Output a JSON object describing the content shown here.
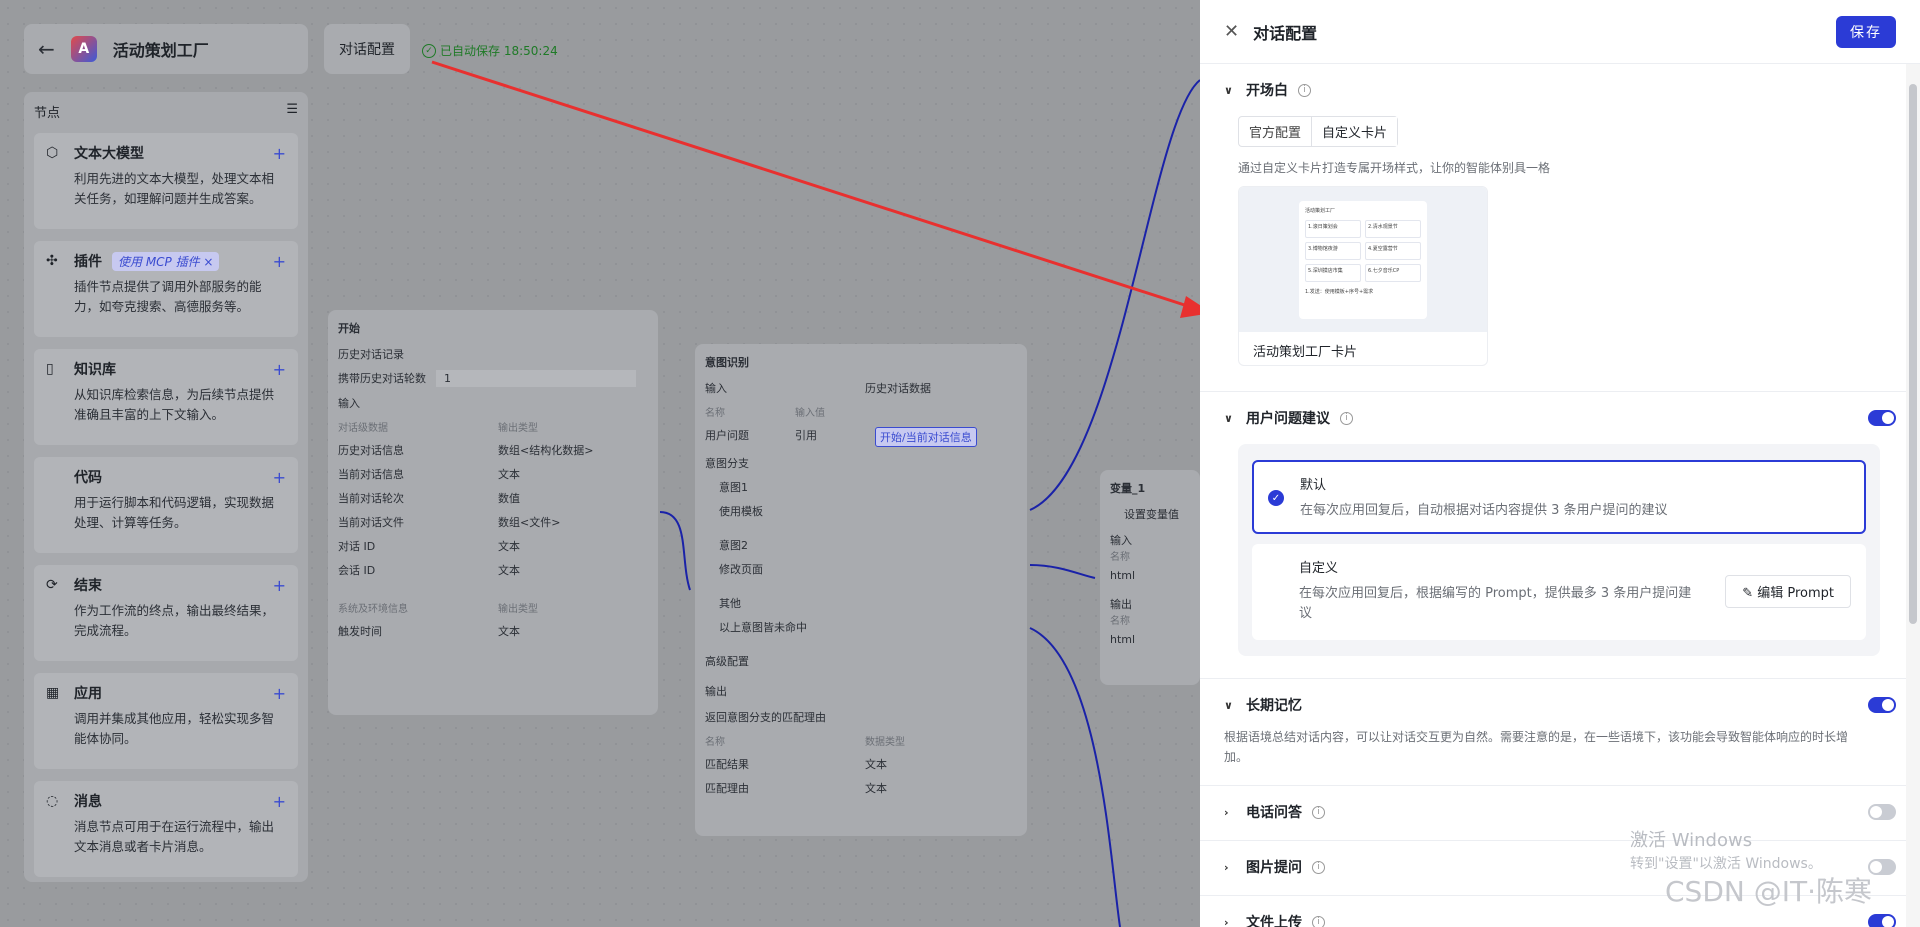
{
  "app": {
    "title": "活动策划工厂",
    "logo_letter": "A",
    "conv_tab": "对话配置",
    "autosave": "已自动保存 18:50:24"
  },
  "nodes": {
    "header": "节点",
    "items": [
      {
        "name": "文本大模型",
        "icon": "cube-icon",
        "desc": "利用先进的文本大模型，处理文本相关任务，如理解问题并生成答案。"
      },
      {
        "name": "插件",
        "icon": "puzzle-icon",
        "badge": "使用 MCP 插件 ×",
        "desc": "插件节点提供了调用外部服务的能力，如夸克搜索、高德服务等。"
      },
      {
        "name": "知识库",
        "icon": "book-icon",
        "desc": "从知识库检索信息，为后续节点提供准确且丰富的上下文输入。"
      },
      {
        "name": "代码",
        "icon": "code-icon",
        "desc": "用于运行脚本和代码逻辑，实现数据处理、计算等任务。"
      },
      {
        "name": "结束",
        "icon": "end-icon",
        "desc": "作为工作流的终点，输出最终结果，完成流程。"
      },
      {
        "name": "应用",
        "icon": "grid-icon",
        "desc": "调用并集成其他应用，轻松实现多智能体协同。"
      },
      {
        "name": "消息",
        "icon": "message-icon",
        "desc": "消息节点可用于在运行流程中，输出文本消息或者卡片消息。"
      }
    ]
  },
  "start_node": {
    "title": "开始",
    "history": "历史对话记录",
    "carry_label": "携带历史对话轮数",
    "carry_value": "1",
    "input": "输入",
    "col1": "对话级数据",
    "col2": "输出类型",
    "rows": [
      [
        "历史对话信息",
        "数组<结构化数据>"
      ],
      [
        "当前对话信息",
        "文本"
      ],
      [
        "当前对话轮次",
        "数值"
      ],
      [
        "当前对话文件",
        "数组<文件>"
      ],
      [
        "对话 ID",
        "文本"
      ],
      [
        "会话 ID",
        "文本"
      ]
    ],
    "col3": "系统及环境信息",
    "col4": "输出类型",
    "trigger": [
      "触发时间",
      "文本"
    ]
  },
  "intent_node": {
    "title": "意图识别",
    "input": "输入",
    "history_chk": "历史对话数据",
    "name_lbl": "名称",
    "val_lbl": "输入值",
    "user_q": "用户问题",
    "ref": "引用",
    "pill": "开始/当前对话信息",
    "branch": "意图分支",
    "i1": "意图1",
    "i1v": "使用模板",
    "i2": "意图2",
    "i2v": "修改页面",
    "other": "其他",
    "other_v": "以上意图皆未命中",
    "adv": "高级配置",
    "output": "输出",
    "ret": "返回意图分支的匹配理由",
    "oc1": "名称",
    "oc2": "数据类型",
    "out_rows": [
      [
        "匹配结果",
        "文本"
      ],
      [
        "匹配理由",
        "文本"
      ]
    ]
  },
  "var_node": {
    "title": "变量_1",
    "btn": "设置变量值",
    "input": "输入",
    "name": "名称",
    "v1": "html",
    "output": "输出",
    "name2": "名称",
    "v2": "html"
  },
  "drawer": {
    "title": "对话配置",
    "save": "保存",
    "opening": {
      "title": "开场白",
      "seg": [
        "官方配置",
        "自定义卡片"
      ],
      "hint": "通过自定义卡片打造专属开场样式，让你的智能体别具一格",
      "card_caption": "活动策划工厂卡片",
      "mini": {
        "head": "活动策划工厂",
        "cells": [
          "1.滚日策划会",
          "2.清水观景节",
          "3.博物馆夜游",
          "4.夏空露营节",
          "5.深圳摸店市集",
          "6.七夕音乐CP"
        ],
        "foot": "1.发送：使用模板+序号+需求"
      }
    },
    "suggest": {
      "title": "用户问题建议",
      "on": true,
      "opt1_t": "默认",
      "opt1_d": "在每次应用回复后，自动根据对话内容提供 3 条用户提问的建议",
      "opt2_t": "自定义",
      "opt2_d": "在每次应用回复后，根据编写的 Prompt，提供最多 3 条用户提问建议",
      "edit": "编辑 Prompt"
    },
    "memory": {
      "title": "长期记忆",
      "on": true,
      "desc": "根据语境总结对话内容，可以让对话交互更为自然。需要注意的是，在一些语境下，该功能会导致智能体响应的时长增加。"
    },
    "phone": {
      "title": "电话问答",
      "on": false
    },
    "image": {
      "title": "图片提问",
      "on": false
    },
    "file": {
      "title": "文件上传",
      "on": true
    }
  },
  "watermark": {
    "line1": "激活 Windows",
    "line2": "转到\"设置\"以激活 Windows。",
    "csdn": "CSDN @IT·陈寒"
  },
  "colors": {
    "accent": "#2b3bd6",
    "arrow": "#e8302f",
    "edge": "#1a22a8"
  }
}
